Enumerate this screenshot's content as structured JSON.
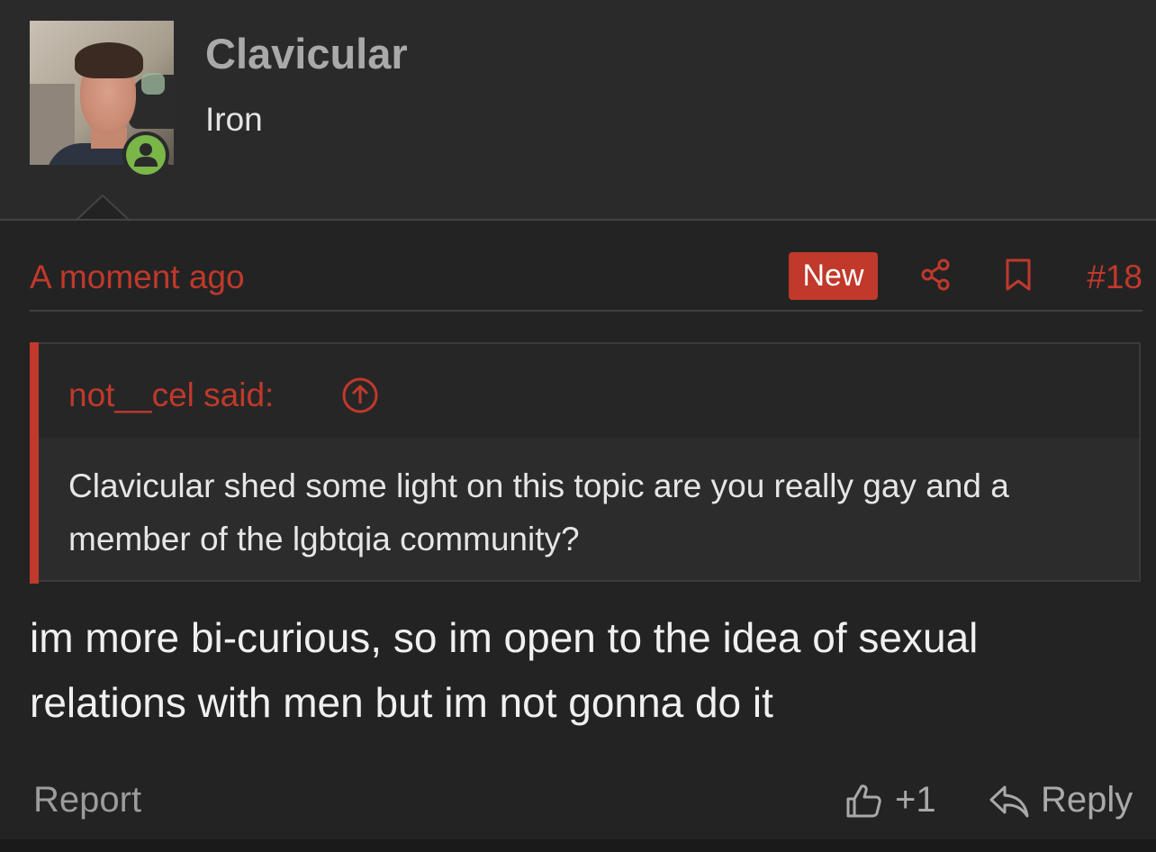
{
  "user": {
    "username": "Clavicular",
    "title": "Iron",
    "avatar_icon": "user-photo",
    "online_icon": "user-online-icon"
  },
  "post": {
    "time": "A moment ago",
    "new_badge": "New",
    "share_icon": "share-icon",
    "bookmark_icon": "bookmark-icon",
    "number": "#18",
    "message": "im more bi-curious, so im open to the idea of sexual relations with men but im not gonna do it"
  },
  "quote": {
    "author": "not__cel said:",
    "jump_icon": "arrow-up-circle-icon",
    "text": "Clavicular shed some light on this topic are you really gay and a member of the lgbtqia community?"
  },
  "actions": {
    "report": "Report",
    "like_count": "+1",
    "reply": "Reply"
  },
  "colors": {
    "accent": "#c0392b",
    "online": "#7ab648",
    "background": "#232324"
  }
}
